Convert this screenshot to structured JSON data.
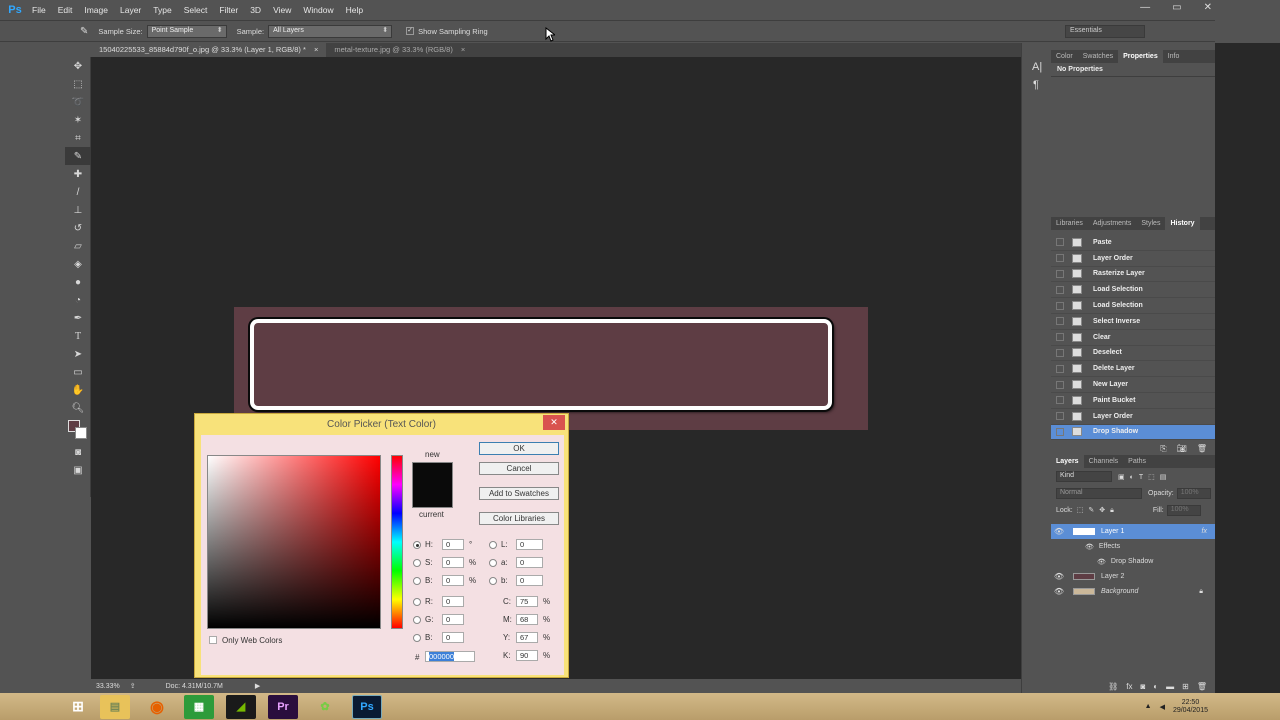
{
  "app": {
    "logo": "Ps"
  },
  "menu": [
    "File",
    "Edit",
    "Image",
    "Layer",
    "Type",
    "Select",
    "Filter",
    "3D",
    "View",
    "Window",
    "Help"
  ],
  "window_controls": [
    "—",
    "▭",
    "✕"
  ],
  "options": {
    "sample_size_label": "Sample Size:",
    "sample_size_value": "Point Sample",
    "sample_label": "Sample:",
    "sample_value": "All Layers",
    "show_ring": "Show Sampling Ring",
    "workspace": "Essentials"
  },
  "tabs": [
    {
      "label": "15040225533_85884d790f_o.jpg @ 33.3% (Layer 1, RGB/8) *"
    },
    {
      "label": "metal-texture.jpg @ 33.3% (RGB/8)"
    }
  ],
  "status": {
    "zoom": "33.33%",
    "doc": "Doc: 4.31M/10.7M"
  },
  "props_panel": {
    "tabs": [
      "Color",
      "Swatches",
      "Properties",
      "Info"
    ],
    "active": "Properties",
    "content": "No Properties"
  },
  "history_panel": {
    "tabs": [
      "Libraries",
      "Adjustments",
      "Styles",
      "History"
    ],
    "active": "History",
    "items": [
      "Paste",
      "Layer Order",
      "Rasterize Layer",
      "Load Selection",
      "Load Selection",
      "Select Inverse",
      "Clear",
      "Deselect",
      "Delete Layer",
      "New Layer",
      "Paint Bucket",
      "Layer Order",
      "Drop Shadow"
    ],
    "selected_index": 12
  },
  "layers_panel": {
    "tabs": [
      "Layers",
      "Channels",
      "Paths"
    ],
    "kind": "Kind",
    "blend_mode": "Normal",
    "opacity_label": "Opacity:",
    "opacity_value": "100%",
    "lock_label": "Lock:",
    "fill_label": "Fill:",
    "fill_value": "100%",
    "layers": [
      {
        "name": "Layer 1",
        "fx": "fx"
      },
      {
        "name": "Effects"
      },
      {
        "name": "Drop Shadow"
      },
      {
        "name": "Layer 2"
      },
      {
        "name": "Background"
      }
    ]
  },
  "color_picker": {
    "title": "Color Picker (Text Color)",
    "new_label": "new",
    "current_label": "current",
    "ok": "OK",
    "cancel": "Cancel",
    "add_swatches": "Add to Swatches",
    "color_libraries": "Color Libraries",
    "only_web": "Only Web Colors",
    "H": "0",
    "S": "0",
    "B": "0",
    "R": "0",
    "G": "0",
    "Bl": "0",
    "L": "0",
    "a": "0",
    "b": "0",
    "C": "75",
    "M": "68",
    "Y": "67",
    "K": "90",
    "hex": "000000",
    "deg": "°",
    "pct": "%"
  },
  "clock": {
    "time": "22:50",
    "date": "29/04/2015"
  },
  "colors": {
    "canvas_bg": "#5e3d44",
    "accent": "#5b8ed6"
  }
}
